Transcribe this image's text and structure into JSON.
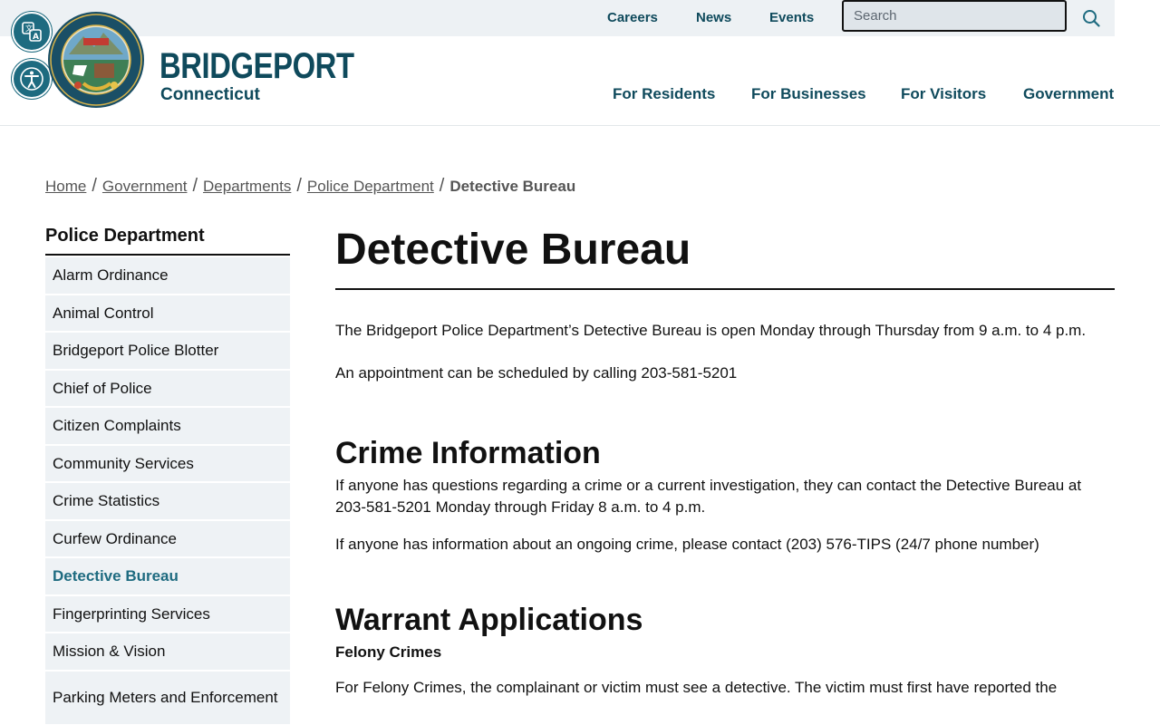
{
  "utility": {
    "links": [
      "Careers",
      "News",
      "Events"
    ],
    "search_placeholder": "Search"
  },
  "brand": {
    "name": "BRIDGEPORT",
    "subtitle": "Connecticut",
    "seal_alt": "Seal of the City of Bridgeport Connecticut"
  },
  "main_nav": [
    "For Residents",
    "For Businesses",
    "For Visitors",
    "Government"
  ],
  "breadcrumb": {
    "links": [
      "Home",
      "Government",
      "Departments",
      "Police Department"
    ],
    "current": "Detective Bureau"
  },
  "sidebar": {
    "title": "Police Department",
    "items": [
      "Alarm Ordinance",
      "Animal Control",
      "Bridgeport Police Blotter",
      "Chief of Police",
      "Citizen Complaints",
      "Community Services",
      "Crime Statistics",
      "Curfew Ordinance",
      "Detective Bureau",
      "Fingerprinting Services",
      "Mission & Vision",
      "Parking Meters and Enforcement"
    ],
    "active_item": "Detective Bureau"
  },
  "main": {
    "title": "Detective Bureau",
    "intro_1": "The Bridgeport Police Department’s Detective Bureau is open Monday through Thursday from 9 a.m. to 4 p.m.",
    "intro_2": "An appointment can be scheduled by calling 203-581-5201",
    "crime_heading": "Crime Information",
    "crime_p1": "If anyone has questions regarding a crime or a current investigation, they can contact the Detective Bureau at 203-581-5201 Monday through Friday 8 a.m. to 4 p.m.",
    "crime_p2": "If anyone has information about an ongoing crime, please contact (203) 576-TIPS (24/7 phone number)",
    "warrant_heading": "Warrant Applications",
    "felony_heading": "Felony Crimes",
    "felony_p1": "For Felony Crimes, the complainant or victim must see a detective. The victim must first have reported the"
  },
  "colors": {
    "brand_teal": "#0f4a5c",
    "accent_teal": "#1e6b80",
    "utility_bg": "#edf1f4",
    "sidebar_item_bg": "#eef2f5"
  }
}
